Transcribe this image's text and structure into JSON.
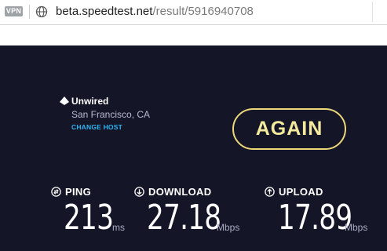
{
  "browser": {
    "vpn_label": "VPN",
    "url_host": "beta.speedtest.net",
    "url_path": "/result/5916940708"
  },
  "server": {
    "isp_name": "Unwired",
    "location": "San Francisco, CA",
    "change_host_label": "CHANGE HOST"
  },
  "actions": {
    "again_label": "AGAIN"
  },
  "metrics": {
    "ping": {
      "label": "PING",
      "value": "213",
      "unit": "ms"
    },
    "download": {
      "label": "DOWNLOAD",
      "value": "27.18",
      "unit": "Mbps"
    },
    "upload": {
      "label": "UPLOAD",
      "value": "17.89",
      "unit": "Mbps"
    }
  },
  "colors": {
    "background": "#141526",
    "accent_yellow": "#ecd87a",
    "link_blue": "#2fb5f5"
  },
  "icons": {
    "address_bar": "globe-icon",
    "isp": "isp-logo-icon",
    "ping": "ping-icon",
    "download": "download-arrow-icon",
    "upload": "upload-arrow-icon"
  }
}
